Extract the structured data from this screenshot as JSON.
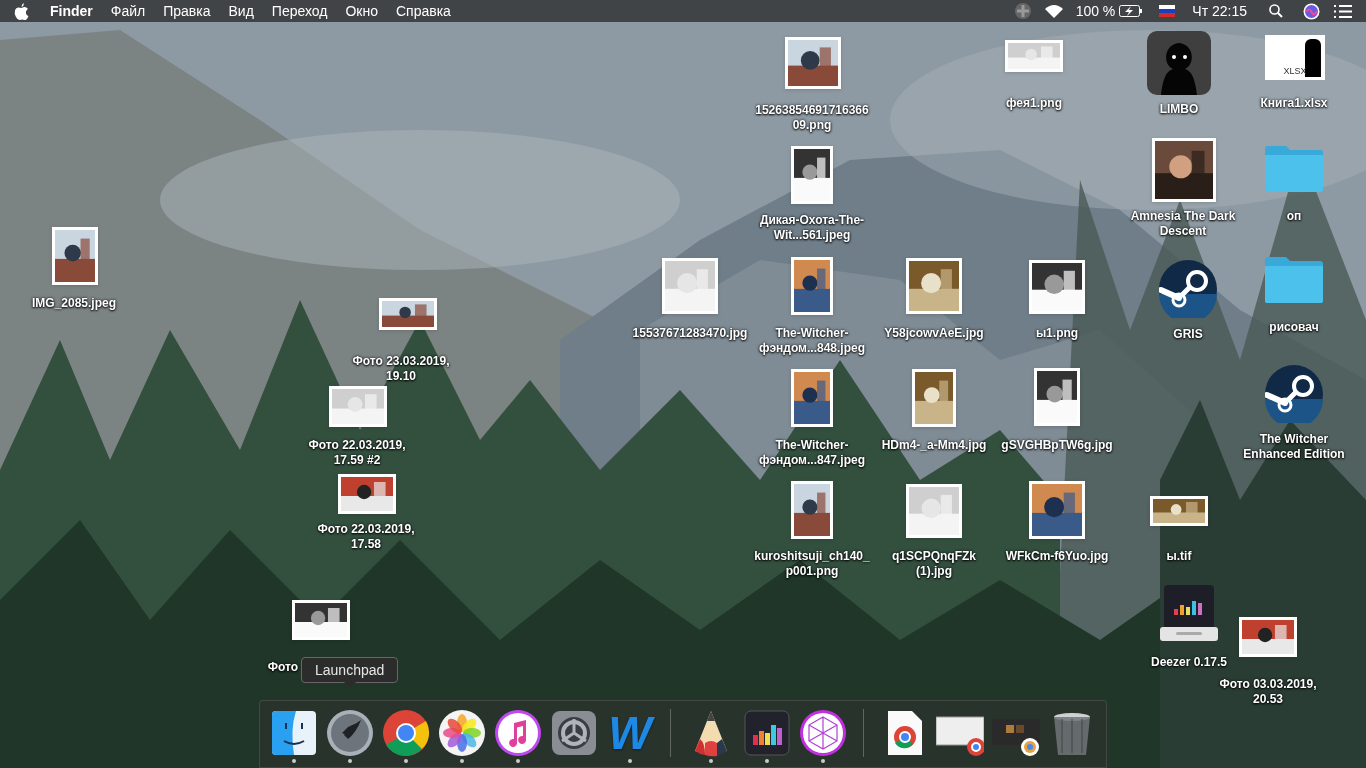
{
  "menubar": {
    "app_name": "Finder",
    "menus": [
      "Файл",
      "Правка",
      "Вид",
      "Переход",
      "Окно",
      "Справка"
    ],
    "battery": "100 %",
    "clock": "Чт 22:15"
  },
  "desktop": {
    "items": [
      {
        "label": "1526385469171636609.png"
      },
      {
        "label": "фея1.png"
      },
      {
        "label": "LIMBO",
        "kind": "silhouette"
      },
      {
        "label": "Книга1.xlsx",
        "kind": "spreadsheet",
        "badge": "XLSX"
      },
      {
        "label": "Дикая-Охота-The-Wit...561.jpeg"
      },
      {
        "label": "Amnesia The Dark Descent",
        "kind": "artwork"
      },
      {
        "label": "оп",
        "kind": "folder"
      },
      {
        "label": "IMG_2085.jpeg"
      },
      {
        "label": "15537671283470.jpg"
      },
      {
        "label": "The-Witcher-фэндом...848.jpeg"
      },
      {
        "label": "Y58jcowvAeE.jpg"
      },
      {
        "label": "ы1.png"
      },
      {
        "label": "GRIS",
        "kind": "steam"
      },
      {
        "label": "рисовач",
        "kind": "folder"
      },
      {
        "label": "Фото 23.03.2019, 19.10"
      },
      {
        "label": "Фото 22.03.2019, 17.59 #2"
      },
      {
        "label": "The-Witcher-фэндом...847.jpeg"
      },
      {
        "label": "HDm4-_a-Mm4.jpg"
      },
      {
        "label": "gSVGHBpTW6g.jpg"
      },
      {
        "label": "The Witcher Enhanced Edition",
        "kind": "steam"
      },
      {
        "label": "Фото 22.03.2019, 17.58"
      },
      {
        "label": "kuroshitsuji_ch140_p001.png"
      },
      {
        "label": "q1SCPQnqFZk (1).jpg"
      },
      {
        "label": "WFkCm-f6Yuo.jpg"
      },
      {
        "label": "ы.tif"
      },
      {
        "label": "Фото"
      },
      {
        "label": "Deezer 0.17.5",
        "kind": "drive"
      },
      {
        "label": "Фото 03.03.2019, 20.53"
      }
    ]
  },
  "dock": {
    "tooltip": "Launchpad",
    "items": [
      {
        "kind": "finder",
        "running": true
      },
      {
        "kind": "launchpad",
        "running": true
      },
      {
        "kind": "browser",
        "running": true
      },
      {
        "kind": "photos",
        "running": true
      },
      {
        "kind": "music",
        "running": true
      },
      {
        "kind": "settings",
        "running": false
      },
      {
        "kind": "writer",
        "running": true,
        "glyph": "W"
      },
      {
        "kind": "separator"
      },
      {
        "kind": "pencil",
        "running": true
      },
      {
        "kind": "equalizer",
        "running": true
      },
      {
        "kind": "polyhedron",
        "running": true
      },
      {
        "kind": "separator"
      },
      {
        "kind": "document",
        "running": false
      },
      {
        "kind": "window",
        "running": false
      },
      {
        "kind": "window2",
        "running": false
      },
      {
        "kind": "trash",
        "running": false
      }
    ]
  }
}
